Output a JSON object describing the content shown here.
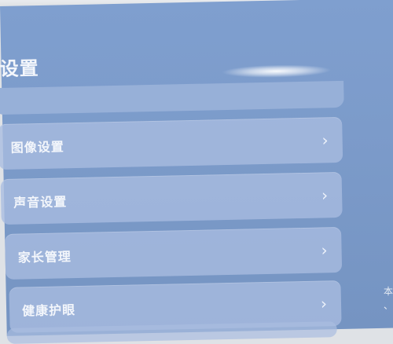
{
  "page": {
    "title": "设置"
  },
  "menu": {
    "items": [
      {
        "label": "图像设置",
        "chevron": "›"
      },
      {
        "label": "声音设置",
        "chevron": "›"
      },
      {
        "label": "家长管理",
        "chevron": "›"
      },
      {
        "label": "健康护眼",
        "chevron": "›"
      }
    ]
  },
  "side": {
    "line1": "本",
    "line2": "、"
  },
  "icons": {
    "chevron": "chevron-right-icon"
  },
  "colors": {
    "screen": "#7f9fcf",
    "card": "#a9bde0",
    "text": "#f3f6fb"
  }
}
